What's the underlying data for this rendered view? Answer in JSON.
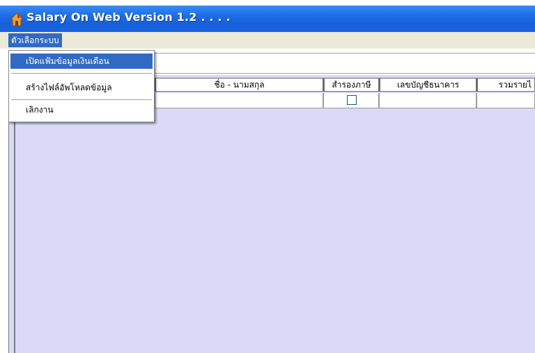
{
  "window": {
    "title": "Salary On Web Version 1.2 . . . ."
  },
  "menubar": {
    "system_menu": "ตัวเลือกระบบ"
  },
  "dropdown": {
    "items": [
      {
        "label": "เปิดแฟ้มข้อมูลเงินเดือน"
      },
      {
        "label": "สร้างไฟล์อัพโหลดข้อมูล"
      },
      {
        "label": "เลิกงาน"
      }
    ]
  },
  "grid": {
    "columns": [
      "ชื่อ - นามสกุล",
      "สำรองภาษี",
      "เลขบัญชีธนาคาร",
      "รวมรายไ"
    ],
    "rows": [
      {
        "tax_reserve_checked": false
      }
    ]
  },
  "colors": {
    "titlebar": "#1f6fe6",
    "menu_highlight": "#316ac5",
    "grid_background": "#dad9f8",
    "menubar": "#ece9d8"
  }
}
